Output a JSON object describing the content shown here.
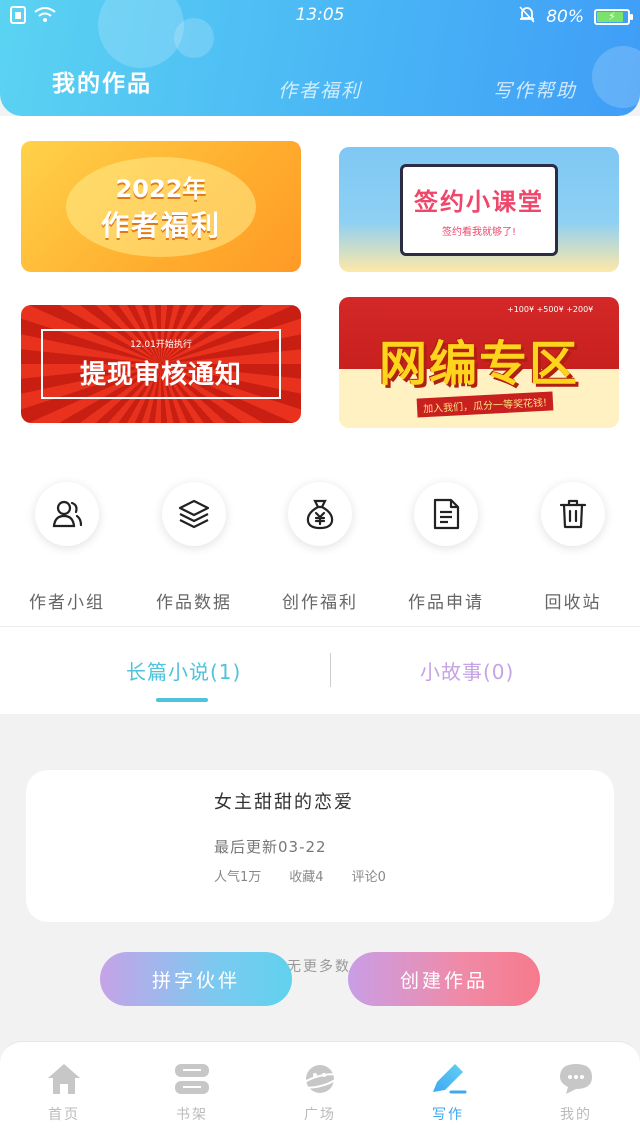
{
  "status_bar": {
    "time": "13:05",
    "battery": "80%",
    "battery_level": 0.8
  },
  "header": {
    "tabs": [
      {
        "label": "我的作品",
        "active": true
      },
      {
        "label": "作者福利",
        "active": false
      },
      {
        "label": "写作帮助",
        "active": false
      }
    ]
  },
  "banners": {
    "welfare": {
      "year": "2022年",
      "title": "作者福利"
    },
    "contract": {
      "title": "签约小课堂",
      "subtitle": "签约看我就够了!"
    },
    "withdraw": {
      "note": "12.01开始执行",
      "title": "提现审核通知"
    },
    "editor": {
      "title": "网编专区",
      "tag": "加入我们，瓜分一等奖花钱!",
      "nums": "+100¥  +500¥  +200¥"
    }
  },
  "quick_actions": [
    {
      "label": "作者小组",
      "icon": "people-icon"
    },
    {
      "label": "作品数据",
      "icon": "layers-icon"
    },
    {
      "label": "创作福利",
      "icon": "money-bag-icon"
    },
    {
      "label": "作品申请",
      "icon": "document-icon"
    },
    {
      "label": "回收站",
      "icon": "trash-icon"
    }
  ],
  "work_tabs": [
    {
      "label": "长篇小说(1)",
      "active": true
    },
    {
      "label": "小故事(0)",
      "active": false
    }
  ],
  "works": [
    {
      "title": "女主甜甜的恋爱",
      "updated": "最后更新03-22",
      "popularity": "人气1万",
      "favorites": "收藏4",
      "comments": "评论0"
    }
  ],
  "no_more": "无更多数",
  "actions": {
    "partner": "拼字伙伴",
    "create": "创建作品"
  },
  "bottom_nav": [
    {
      "label": "首页",
      "icon": "home-icon",
      "active": false
    },
    {
      "label": "书架",
      "icon": "bookshelf-icon",
      "active": false
    },
    {
      "label": "广场",
      "icon": "planet-icon",
      "active": false
    },
    {
      "label": "写作",
      "icon": "pen-icon",
      "active": true
    },
    {
      "label": "我的",
      "icon": "chat-bubble-icon",
      "active": false
    }
  ],
  "colors": {
    "header_start": "#5bd3f2",
    "header_end": "#3f9df7",
    "active_tab": "#4fc3dc",
    "inactive_tab": "#c6a3e5",
    "nav_active": "#3ea8f2"
  }
}
